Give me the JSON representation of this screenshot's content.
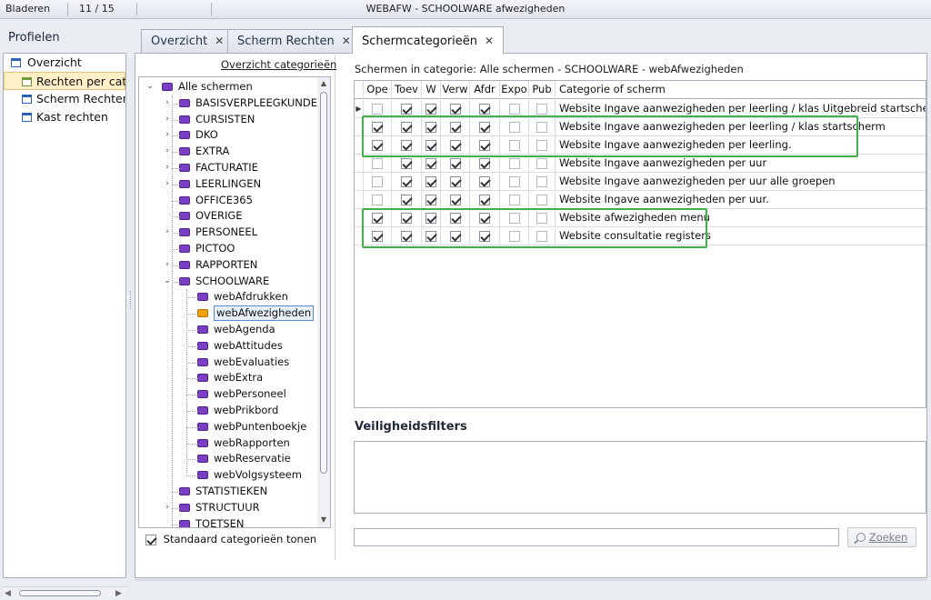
{
  "topbar": {
    "browse_label": "Bladeren",
    "record_position": "11 / 15",
    "window_title": "WEBAFW - SCHOOLWARE afwezigheden"
  },
  "profiles": {
    "title": "Profielen",
    "items": [
      {
        "label": "Overzicht"
      },
      {
        "label": "Rechten per cat"
      },
      {
        "label": "Scherm Rechten"
      },
      {
        "label": "Kast rechten"
      }
    ]
  },
  "tabs": [
    {
      "label": "Overzicht",
      "close": "✕"
    },
    {
      "label": "Scherm Rechten",
      "close": "✕"
    },
    {
      "label": "Schermcategorieën",
      "close": "✕"
    }
  ],
  "categories": {
    "overview_link": "Overzicht categorieën",
    "root": "Alle schermen",
    "nodes": [
      "BASISVERPLEEGKUNDE",
      "CURSISTEN",
      "DKO",
      "EXTRA",
      "FACTURATIE",
      "LEERLINGEN",
      "OFFICE365",
      "OVERIGE",
      "PERSONEEL",
      "PICTOO",
      "RAPPORTEN",
      "SCHOOLWARE"
    ],
    "schoolware_children": [
      "webAfdrukken",
      "webAfwezigheden",
      "webAgenda",
      "webAttitudes",
      "webEvaluaties",
      "webExtra",
      "webPersoneel",
      "webPrikbord",
      "webPuntenboekje",
      "webRapporten",
      "webReservatie",
      "webVolgsysteem"
    ],
    "tail_nodes": [
      "STATISTIEKEN",
      "STRUCTUUR",
      "TOETSEN"
    ],
    "selected": "webAfwezigheden",
    "show_default_label": "Standaard categorieën tonen",
    "show_default_checked": true
  },
  "grid": {
    "caption": "Schermen in categorie: Alle schermen - SCHOOLWARE - webAfwezigheden",
    "columns": [
      "Ope",
      "Toev",
      "W",
      "Verw",
      "Afdr",
      "Expo",
      "Pub",
      "Categorie of scherm"
    ],
    "rows": [
      {
        "current": true,
        "checks": [
          false,
          true,
          true,
          true,
          true,
          false,
          false
        ],
        "name": "Website Ingave aanwezigheden per leerling / klas Uitgebreid startscherm"
      },
      {
        "current": false,
        "checks": [
          true,
          true,
          true,
          true,
          true,
          false,
          false
        ],
        "name": "Website Ingave aanwezigheden per leerling / klas startscherm"
      },
      {
        "current": false,
        "checks": [
          true,
          true,
          true,
          true,
          true,
          false,
          false
        ],
        "name": "Website Ingave aanwezigheden per leerling."
      },
      {
        "current": false,
        "checks": [
          false,
          true,
          true,
          true,
          true,
          false,
          false
        ],
        "name": "Website Ingave aanwezigheden per uur"
      },
      {
        "current": false,
        "checks": [
          false,
          true,
          true,
          true,
          true,
          false,
          false
        ],
        "name": "Website Ingave aanwezigheden per uur alle groepen"
      },
      {
        "current": false,
        "checks": [
          false,
          true,
          true,
          true,
          true,
          false,
          false
        ],
        "name": "Website Ingave aanwezigheden per uur."
      },
      {
        "current": false,
        "checks": [
          true,
          true,
          true,
          true,
          true,
          false,
          false
        ],
        "name": "Website afwezigheden menu"
      },
      {
        "current": false,
        "checks": [
          true,
          true,
          true,
          true,
          true,
          false,
          false
        ],
        "name": "Website consultatie registers"
      }
    ],
    "highlight_color": "#3fb04a"
  },
  "security": {
    "title": "Veiligheidsfilters",
    "search_value": "",
    "search_button": "Zoeken"
  },
  "colors": {
    "category_icon": "#7b3fc6",
    "selected_category_icon": "#f4a10c",
    "selection_background": "#fff0c7"
  }
}
